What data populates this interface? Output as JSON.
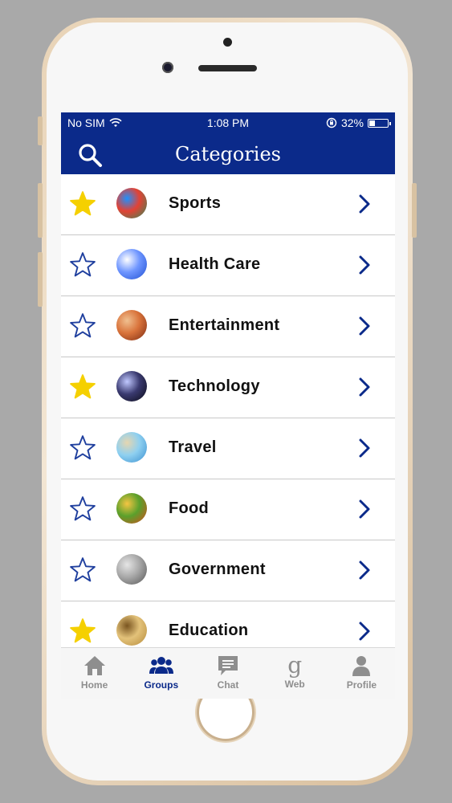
{
  "status_bar": {
    "carrier": "No SIM",
    "time": "1:08 PM",
    "battery": "32%",
    "battery_level": 0.32
  },
  "nav": {
    "title": "Categories",
    "search_icon": "search-icon"
  },
  "categories": [
    {
      "label": "Sports",
      "favorite": true,
      "thumb_colors": [
        "#2e8b57",
        "#e34234",
        "#1e90ff"
      ]
    },
    {
      "label": "Health Care",
      "favorite": false,
      "thumb_colors": [
        "#1f4fd1",
        "#6f96ff",
        "#ffffff"
      ]
    },
    {
      "label": "Entertainment",
      "favorite": false,
      "thumb_colors": [
        "#7a2a12",
        "#d9733b",
        "#f0c090"
      ]
    },
    {
      "label": "Technology",
      "favorite": true,
      "thumb_colors": [
        "#0a0a14",
        "#3a3a70",
        "#c0c8ff"
      ]
    },
    {
      "label": "Travel",
      "favorite": false,
      "thumb_colors": [
        "#3a8fd0",
        "#8fd0f0",
        "#e6d6b0"
      ]
    },
    {
      "label": "Food",
      "favorite": false,
      "thumb_colors": [
        "#d84a1b",
        "#5aa02c",
        "#f5c542"
      ]
    },
    {
      "label": "Government",
      "favorite": false,
      "thumb_colors": [
        "#555555",
        "#a8a8a8",
        "#e5e5e5"
      ]
    },
    {
      "label": "Education",
      "favorite": true,
      "thumb_colors": [
        "#b58a3a",
        "#e3c27a",
        "#7a5520"
      ]
    }
  ],
  "tabs": [
    {
      "label": "Home",
      "icon": "home-icon",
      "active": false
    },
    {
      "label": "Groups",
      "icon": "groups-icon",
      "active": true
    },
    {
      "label": "Chat",
      "icon": "chat-icon",
      "active": false
    },
    {
      "label": "Web",
      "icon": "google-icon",
      "active": false
    },
    {
      "label": "Profile",
      "icon": "profile-icon",
      "active": false
    }
  ],
  "colors": {
    "brand": "#0b2a8a",
    "star_filled": "#f5d000",
    "star_outline": "#1f3f9e",
    "chevron": "#0b2a8a"
  }
}
